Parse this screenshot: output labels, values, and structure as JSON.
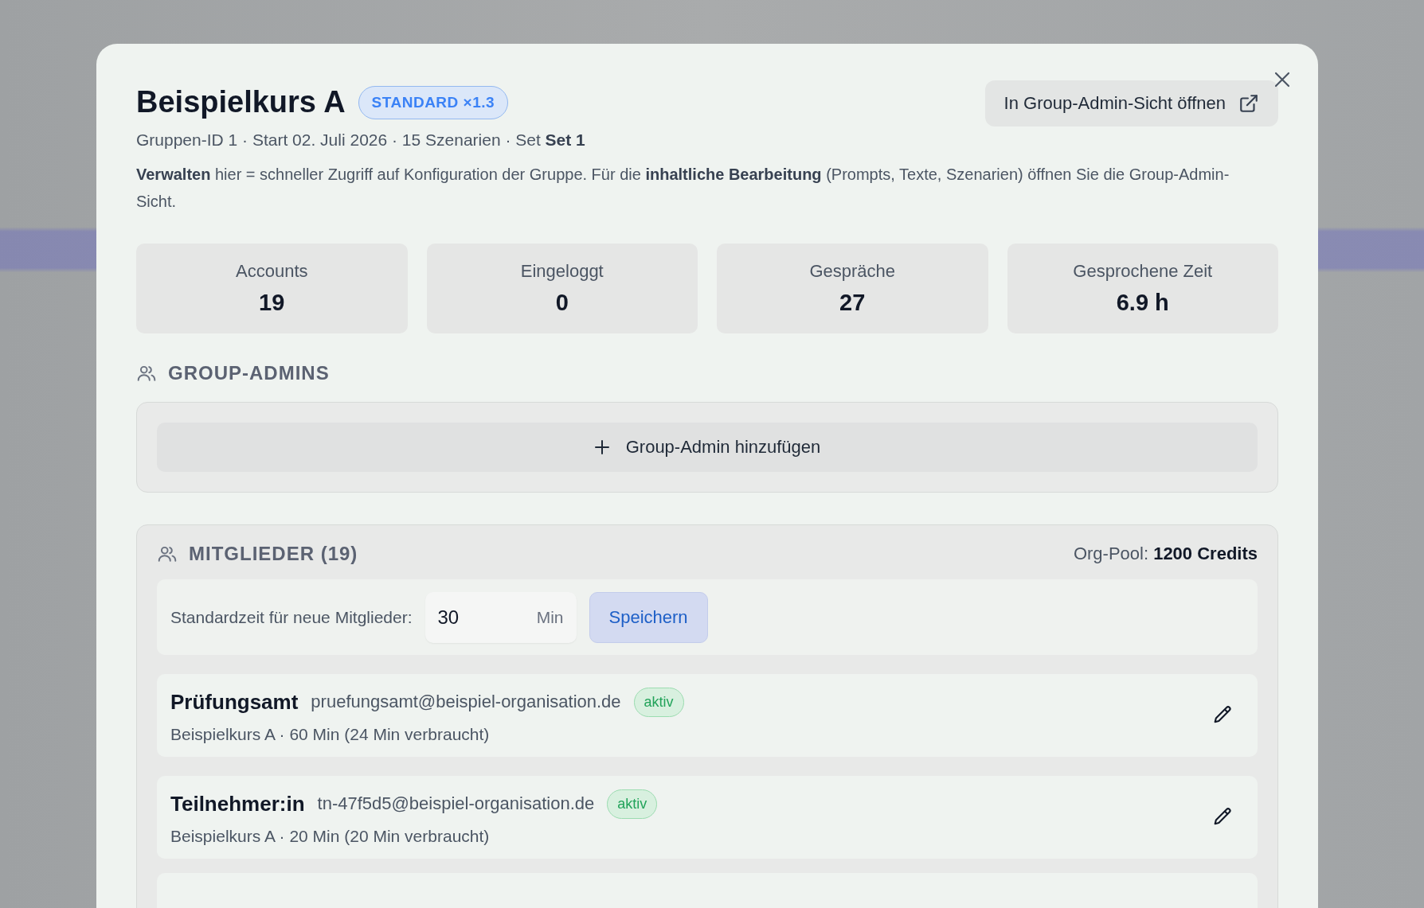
{
  "dialog": {
    "title": "Beispielkurs A",
    "badge": "STANDARD ×1.3",
    "open_button": "In Group-Admin-Sicht öffnen",
    "meta": "Gruppen-ID 1 · Start 02. Juli 2026 · 15 Szenarien · Set **Set 1**",
    "note": "**Verwalten** hier = schneller Zugriff auf Konfiguration der Gruppe. Für die **inhaltliche Bearbeitung** (Prompts, Texte, Szenarien) öffnen Sie die Group-Admin-Sicht."
  },
  "stats": [
    {
      "label": "Accounts",
      "value": "19"
    },
    {
      "label": "Eingeloggt",
      "value": "0"
    },
    {
      "label": "Gespräche",
      "value": "27"
    },
    {
      "label": "Gesprochene Zeit",
      "value": "6.9 h"
    }
  ],
  "group_admins": {
    "heading": "GROUP-ADMINS",
    "add_button": "Group-Admin hinzufügen"
  },
  "members": {
    "heading": "MITGLIEDER (19)",
    "pool": "Org-Pool: **1200 Credits**",
    "default_time": {
      "label": "Standardzeit für neue Mitglieder:",
      "value": "30",
      "unit": "Min",
      "save_button": "Speichern"
    },
    "rows": [
      {
        "name": "Prüfungsamt",
        "email": "pruefungsamt@beispiel-organisation.de",
        "status": "aktiv",
        "detail": "Beispielkurs A · 60 Min (24 Min verbraucht)"
      },
      {
        "name": "Teilnehmer:in",
        "email": "tn-47f5d5@beispiel-organisation.de",
        "status": "aktiv",
        "detail": "Beispielkurs A · 20 Min (20 Min verbraucht)"
      }
    ]
  }
}
